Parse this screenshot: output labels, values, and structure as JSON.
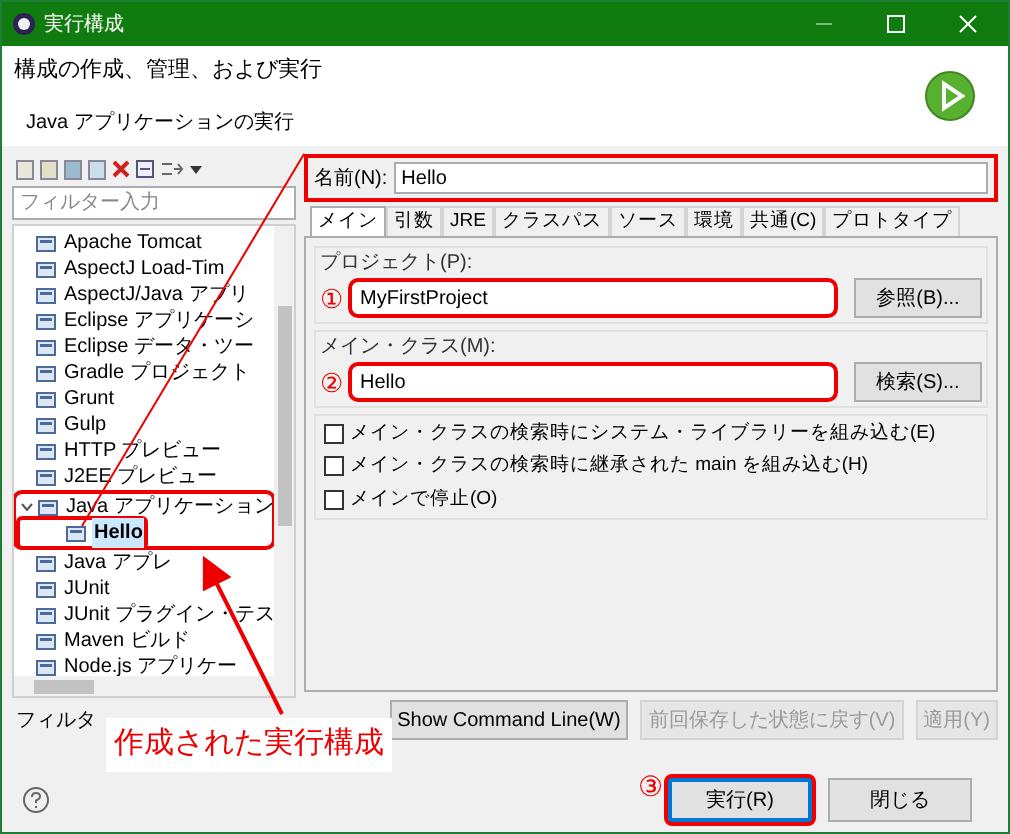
{
  "window": {
    "title": "実行構成"
  },
  "header": {
    "title": "構成の作成、管理、および実行",
    "subtitle": "Java アプリケーションの実行"
  },
  "sidebar": {
    "filter": {
      "placeholder": "フィルター入力"
    },
    "items": [
      {
        "label": "Apache Tomcat",
        "selected": false
      },
      {
        "label": "AspectJ Load-Tim",
        "selected": false
      },
      {
        "label": "AspectJ/Java アプリ",
        "selected": false
      },
      {
        "label": "Eclipse アプリケーシ",
        "selected": false
      },
      {
        "label": "Eclipse データ・ツー",
        "selected": false
      },
      {
        "label": "Gradle プロジェクト",
        "selected": false
      },
      {
        "label": "Grunt",
        "selected": false
      },
      {
        "label": "Gulp",
        "selected": false
      },
      {
        "label": "HTTP プレビュー",
        "selected": false
      },
      {
        "label": "J2EE プレビュー",
        "selected": false
      },
      {
        "label": "Java アプリケーション",
        "selected": false,
        "expanded": true,
        "children": [
          {
            "label": "Hello",
            "selected": true
          }
        ]
      },
      {
        "label": "Java アプレ",
        "selected": false
      },
      {
        "label": "JUnit",
        "selected": false
      },
      {
        "label": "JUnit プラグイン・テス",
        "selected": false
      },
      {
        "label": "Maven ビルド",
        "selected": false
      },
      {
        "label": "Node.js アプリケー",
        "selected": false
      }
    ],
    "status": "フィルタ"
  },
  "name": {
    "label": "名前(N):",
    "value": "Hello"
  },
  "tabs": [
    {
      "label": "メイン",
      "selected": true
    },
    {
      "label": "引数",
      "selected": false
    },
    {
      "label": "JRE",
      "selected": false
    },
    {
      "label": "クラスパス",
      "selected": false
    },
    {
      "label": "ソース",
      "selected": false
    },
    {
      "label": "環境",
      "selected": false
    },
    {
      "label": "共通(C)",
      "selected": false
    },
    {
      "label": "プロトタイプ",
      "selected": false
    }
  ],
  "main_tab": {
    "fields": [
      {
        "label": "プロジェクト(P):",
        "value": "MyFirstProject",
        "button": "参照(B)...",
        "marker": "①"
      },
      {
        "label": "メイン・クラス(M):",
        "value": "Hello",
        "button": "検索(S)...",
        "marker": "②"
      }
    ],
    "options": [
      {
        "label": "メイン・クラスの検索時にシステム・ライブラリーを組み込む(E)",
        "checked": false
      },
      {
        "label": "メイン・クラスの検索時に継承された main を組み込む(H)",
        "checked": false
      },
      {
        "label": "メインで停止(O)",
        "checked": false
      }
    ]
  },
  "actions": [
    {
      "label": "Show Command Line(W)",
      "disabled": false
    },
    {
      "label": "前回保存した状態に戻す(V)",
      "disabled": true
    },
    {
      "label": "適用(Y)",
      "disabled": true
    }
  ],
  "footer": {
    "buttons": [
      {
        "label": "実行(R)",
        "highlighted": true,
        "marker": "③"
      },
      {
        "label": "閉じる",
        "highlighted": false
      }
    ]
  },
  "callout": "作成された実行構成"
}
